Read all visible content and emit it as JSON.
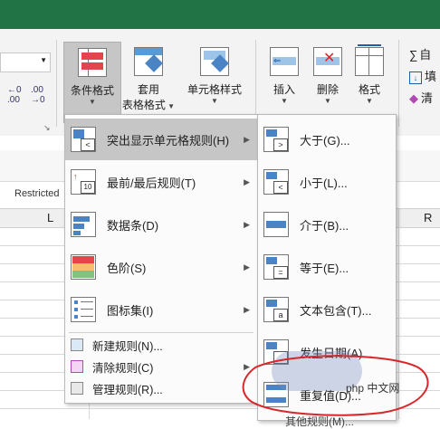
{
  "ribbon": {
    "cond_format": "条件格式",
    "table_format_1": "套用",
    "table_format_2": "表格格式",
    "cell_style": "单元格样式",
    "insert": "插入",
    "delete": "删除",
    "format": "格式",
    "autosum": "自",
    "fill": "填",
    "clear": "清",
    "inc_decimal": "←0 .00",
    "dec_decimal": ".00 →0"
  },
  "sheet": {
    "restricted_label": "Restricted",
    "col_L": "L",
    "col_R": "R"
  },
  "main_menu": {
    "items": [
      {
        "label": "突出显示单元格规则(H)"
      },
      {
        "label": "最前/最后规则(T)"
      },
      {
        "label": "数据条(D)"
      },
      {
        "label": "色阶(S)"
      },
      {
        "label": "图标集(I)"
      },
      {
        "label": "新建规则(N)..."
      },
      {
        "label": "清除规则(C)"
      },
      {
        "label": "管理规则(R)..."
      }
    ]
  },
  "sub_menu": {
    "items": [
      {
        "label": "大于(G)..."
      },
      {
        "label": "小于(L)..."
      },
      {
        "label": "介于(B)..."
      },
      {
        "label": "等于(E)..."
      },
      {
        "label": "文本包含(T)..."
      },
      {
        "label": "发生日期(A)..."
      },
      {
        "label": "重复值(D)..."
      }
    ],
    "partial_label": "其他规则(M)..."
  },
  "watermark": {
    "text": "php 中文网"
  },
  "colors": {
    "excel_green": "#217346",
    "highlight": "#c6c6c6",
    "annotation_red": "#d9262a"
  }
}
